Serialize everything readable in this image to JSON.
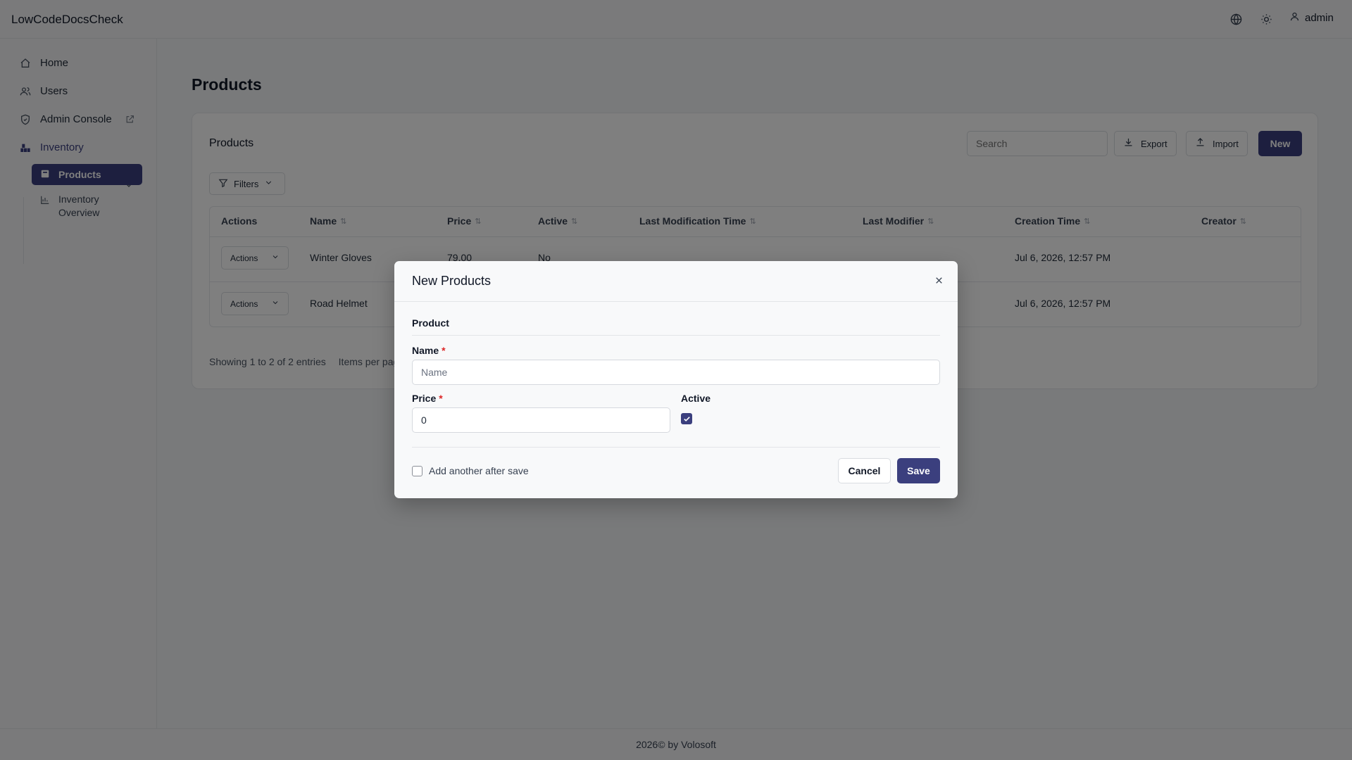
{
  "app": {
    "brand": "LowCodeDocsCheck",
    "user": "admin"
  },
  "colors": {
    "accent": "#3b3f7e",
    "required": "#dc2626"
  },
  "icons": {
    "language": "globe-icon",
    "theme": "sun-icon",
    "user": "user-icon"
  },
  "sidebar": {
    "items": [
      {
        "label": "Home",
        "icon": "home-icon"
      },
      {
        "label": "Users",
        "icon": "users-icon"
      },
      {
        "label": "Admin Console",
        "icon": "shield-icon"
      },
      {
        "label": "Inventory",
        "icon": "inventory-icon"
      }
    ],
    "sub_items": [
      {
        "label": "Products",
        "icon": "box-icon",
        "active": true
      },
      {
        "label": "Inventory Overview",
        "icon": "chart-icon"
      }
    ]
  },
  "main": {
    "page_title": "Products",
    "card_title": "Products",
    "search_placeholder": "Search",
    "export_label": "Export",
    "import_label": "Import",
    "new_label": "New",
    "filters_label": "Filters",
    "columns": [
      "Actions",
      "Name",
      "Price",
      "Active",
      "Last Modification Time",
      "Last Modifier",
      "Creation Time",
      "Creator"
    ],
    "rows": [
      {
        "actions": "Actions",
        "name": "Winter Gloves",
        "price": "79.00",
        "active": "No",
        "last_mod_time": "",
        "last_modifier": "",
        "creation_time": "Jul 6, 2026, 12:57 PM",
        "creator": ""
      },
      {
        "actions": "Actions",
        "name": "Road Helmet",
        "price": "",
        "active": "",
        "last_mod_time": "",
        "last_modifier": "",
        "creation_time": "Jul 6, 2026, 12:57 PM",
        "creator": ""
      }
    ],
    "showing_text": "Showing 1 to 2 of 2 entries",
    "items_per_page_text": "Items per pag"
  },
  "modal": {
    "title": "New Products",
    "section": "Product",
    "name_label": "Name",
    "name_placeholder": "Name",
    "price_label": "Price",
    "price_value": "0",
    "active_label": "Active",
    "active_checked": true,
    "required_mark": "*",
    "add_another_label": "Add another after save",
    "cancel_label": "Cancel",
    "save_label": "Save"
  },
  "footer": {
    "text": "2026© by Volosoft"
  }
}
